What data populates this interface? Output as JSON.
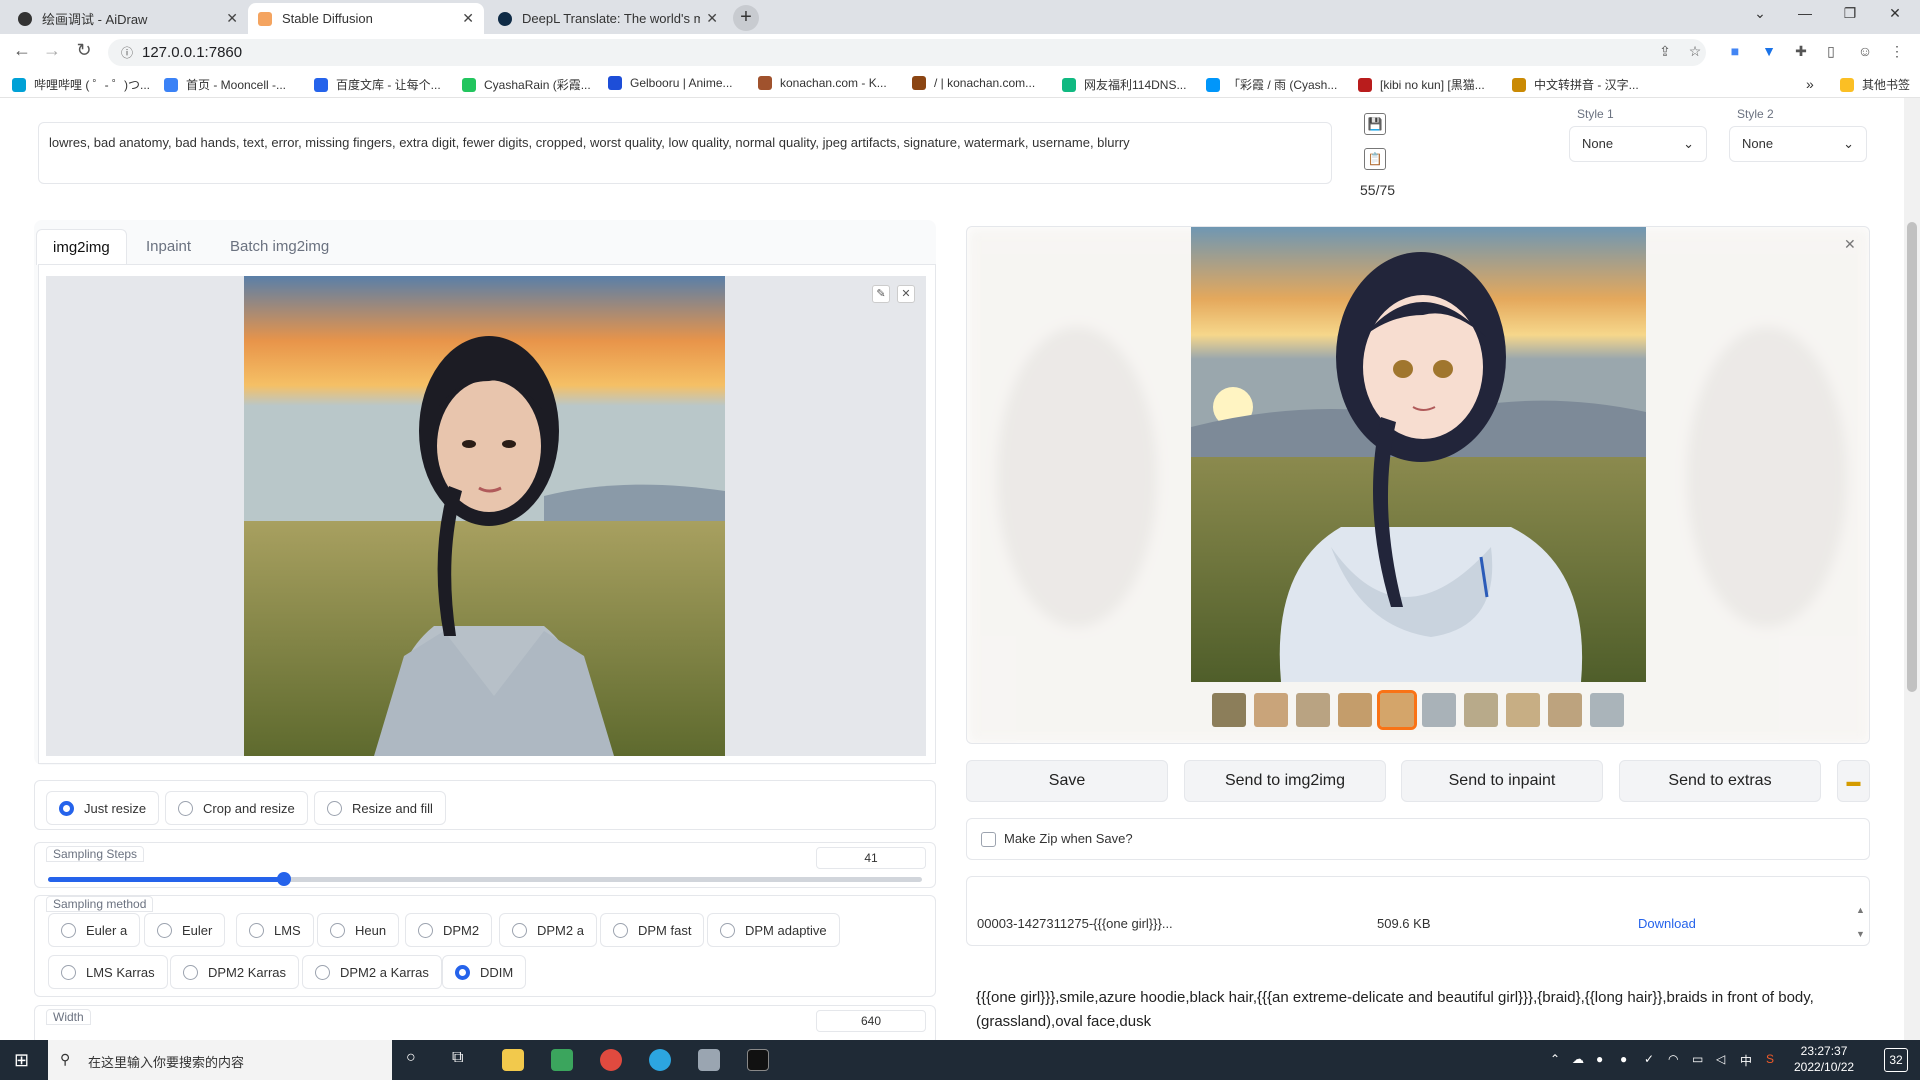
{
  "browser": {
    "tabs": [
      {
        "title": "绘画调试 - AiDraw",
        "close": "✕"
      },
      {
        "title": "Stable Diffusion",
        "close": "✕"
      },
      {
        "title": "DeepL Translate: The world's m",
        "close": "✕"
      }
    ],
    "new_tab": "+",
    "url": "127.0.0.1:7860",
    "bookmarks": [
      "哔哩哔哩 ( ゜- ゜)つ...",
      "首页 - Mooncell -...",
      "百度文库 - 让每个...",
      "CyashaRain (彩霞...",
      "Gelbooru | Anime...",
      "konachan.com - K...",
      "/ | konachan.com...",
      "网友福利114DNS...",
      "「彩霞 / 雨 (Cyash...",
      "[kibi no kun] [黒猫...",
      "中文转拼音 - 汉字..."
    ],
    "more_bookmarks": "»",
    "other_bookmarks": "其他书签"
  },
  "negative_prompt": "lowres, bad anatomy, bad hands, text, error, missing fingers, extra digit, fewer digits, cropped, worst quality, low quality, normal quality, jpeg artifacts, signature, watermark, username, blurry",
  "token_counter": "55/75",
  "styles": [
    {
      "label": "Style 1",
      "value": "None"
    },
    {
      "label": "Style 2",
      "value": "None"
    }
  ],
  "mode_tabs": [
    "img2img",
    "Inpaint",
    "Batch img2img"
  ],
  "resize_modes": [
    {
      "label": "Just resize",
      "checked": true
    },
    {
      "label": "Crop and resize",
      "checked": false
    },
    {
      "label": "Resize and fill",
      "checked": false
    }
  ],
  "sampling_steps": {
    "label": "Sampling Steps",
    "value": "41",
    "fraction": 0.27
  },
  "sampling_method": {
    "label": "Sampling method",
    "options": [
      {
        "label": "Euler a",
        "checked": false
      },
      {
        "label": "Euler",
        "checked": false
      },
      {
        "label": "LMS",
        "checked": false
      },
      {
        "label": "Heun",
        "checked": false
      },
      {
        "label": "DPM2",
        "checked": false
      },
      {
        "label": "DPM2 a",
        "checked": false
      },
      {
        "label": "DPM fast",
        "checked": false
      },
      {
        "label": "DPM adaptive",
        "checked": false
      },
      {
        "label": "LMS Karras",
        "checked": false
      },
      {
        "label": "DPM2 Karras",
        "checked": false
      },
      {
        "label": "DPM2 a Karras",
        "checked": false
      },
      {
        "label": "DDIM",
        "checked": true
      }
    ]
  },
  "width": {
    "label": "Width",
    "value": "640"
  },
  "output": {
    "thumb_count": 10,
    "selected_thumb": 4,
    "buttons": [
      "Save",
      "Send to img2img",
      "Send to inpaint",
      "Send to extras"
    ],
    "make_zip_label": "Make Zip when Save?",
    "file_name": "00003-1427311275-{{{one girl}}}...",
    "file_size": "509.6 KB",
    "download_label": "Download",
    "prompt_text": "{{{one girl}}},smile,azure hoodie,black hair,{{{an extreme-delicate and beautiful girl}}},{braid},{{long hair}},braids in front of body,(grassland),oval face,dusk"
  },
  "taskbar": {
    "search_placeholder": "在这里输入你要搜索的内容",
    "time": "23:27:37",
    "date": "2022/10/22",
    "ime": "中",
    "notif_count": "32"
  },
  "colors": {
    "accent": "#2563eb",
    "selected_thumb": "#f97316"
  }
}
